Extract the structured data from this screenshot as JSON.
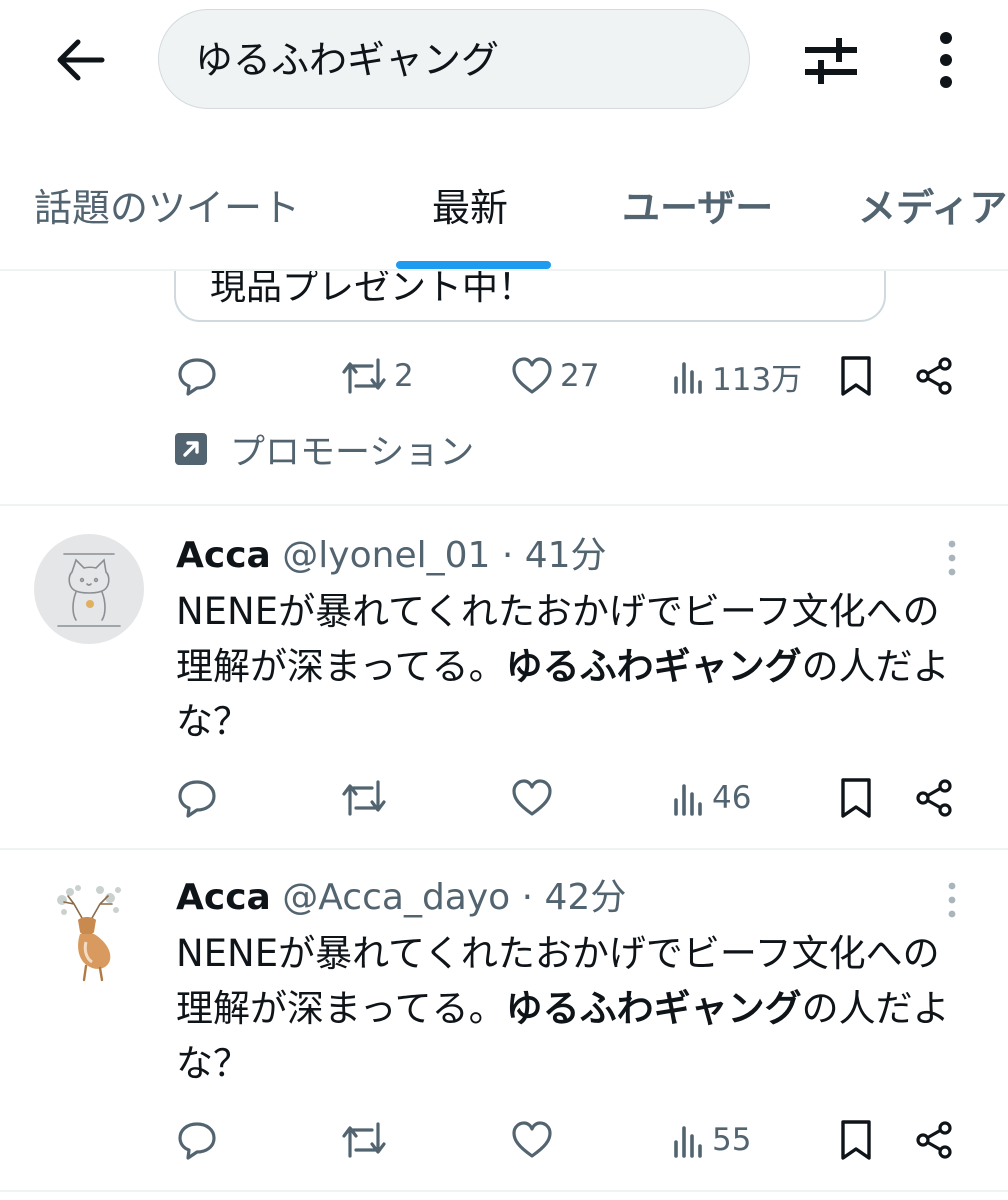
{
  "search": {
    "query": "ゆるふわギャング"
  },
  "tabs": [
    "話題のツイート",
    "最新",
    "ユーザー",
    "メディア"
  ],
  "promo": {
    "card_text": "現品プレゼント中！",
    "reposts": "2",
    "likes": "27",
    "views": "113万",
    "label": "プロモーション"
  },
  "tweets": [
    {
      "name": "Acca",
      "meta": "@lyonel_01 · 41分",
      "text_before": "NENEが暴れてくれたおかげでビーフ文化への理解が深まってる。",
      "text_highlight": "ゆるふわギャング",
      "text_after": "の人だよな？",
      "views": "46"
    },
    {
      "name": "Acca",
      "meta": "@Acca_dayo · 42分",
      "text_before": "NENEが暴れてくれたおかげでビーフ文化への理解が深まってる。",
      "text_highlight": "ゆるふわギャング",
      "text_after": "の人だよな？",
      "views": "55"
    }
  ],
  "colors": {
    "accent": "#1d9bf0",
    "secondary_text": "#536471",
    "border": "#eff3f4"
  }
}
